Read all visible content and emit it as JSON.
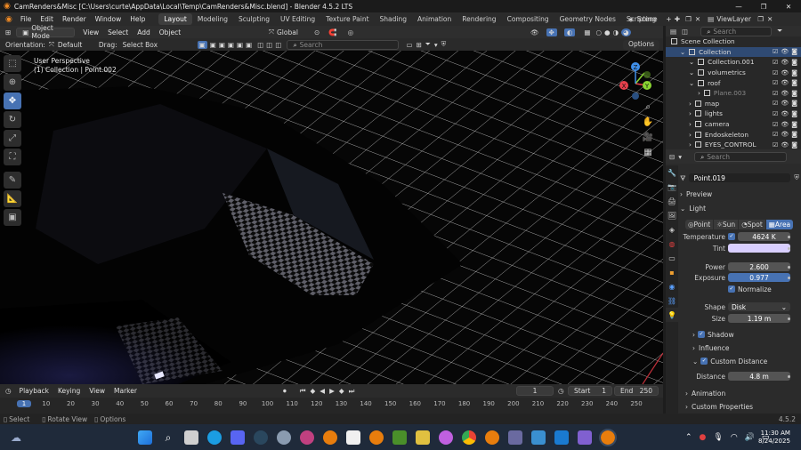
{
  "titlebar": {
    "title": "CamRenders&Misc [C:\\Users\\curte\\AppData\\Local\\Temp\\CamRenders&Misc.blend] - Blender 4.5.2 LTS"
  },
  "menubar": {
    "items": [
      "File",
      "Edit",
      "Render",
      "Window",
      "Help"
    ],
    "workspaces": [
      "Layout",
      "Modeling",
      "Sculpting",
      "UV Editing",
      "Texture Paint",
      "Shading",
      "Animation",
      "Rendering",
      "Compositing",
      "Geometry Nodes",
      "Scripting"
    ],
    "scene": "Scene",
    "view_layer": "ViewLayer"
  },
  "viewport_header": {
    "mode": "Object Mode",
    "menus": [
      "View",
      "Select",
      "Add",
      "Object"
    ],
    "transform": "Global"
  },
  "orientation_bar": {
    "orientation_label": "Orientation:",
    "orientation_value": "Default",
    "drag_label": "Drag:",
    "drag_value": "Select Box",
    "search_placeholder": "Search",
    "options": "Options"
  },
  "viewport": {
    "perspective": "User Perspective",
    "collection_info": "(1) Collection | Point.002"
  },
  "gizmo": {
    "x": "X",
    "y": "Y",
    "z": "Z"
  },
  "timeline": {
    "menus": [
      "Playback",
      "Keying",
      "View",
      "Marker"
    ],
    "current_frame": "1",
    "start_label": "Start",
    "start": "1",
    "end_label": "End",
    "end": "250",
    "ticks": [
      "1",
      "10",
      "20",
      "30",
      "40",
      "50",
      "60",
      "70",
      "80",
      "90",
      "100",
      "110",
      "120",
      "130",
      "140",
      "150",
      "160",
      "170",
      "180",
      "190",
      "200",
      "210",
      "220",
      "230",
      "240",
      "250"
    ]
  },
  "statusbar": {
    "select": "Select",
    "rotate": "Rotate View",
    "options": "Options",
    "version": "4.5.2"
  },
  "outliner": {
    "search_placeholder": "Search",
    "items": [
      {
        "name": "Scene Collection",
        "indent": 0
      },
      {
        "name": "Collection",
        "indent": 1
      },
      {
        "name": "Collection.001",
        "indent": 2
      },
      {
        "name": "volumetrics",
        "indent": 2
      },
      {
        "name": "roof",
        "indent": 2
      },
      {
        "name": "Plane.003",
        "indent": 3
      },
      {
        "name": "map",
        "indent": 2
      },
      {
        "name": "lights",
        "indent": 2
      },
      {
        "name": "camera",
        "indent": 2
      },
      {
        "name": "Endoskeleton",
        "indent": 2
      },
      {
        "name": "EYES_CONTROL",
        "indent": 2
      }
    ]
  },
  "properties": {
    "search_placeholder": "Search",
    "object_name": "Point.019",
    "preview": "Preview",
    "light": "Light",
    "light_types": [
      "Point",
      "Sun",
      "Spot",
      "Area"
    ],
    "temperature_label": "Temperature",
    "temperature": "4624 K",
    "tint_label": "Tint",
    "tint_color": "#d9cfff",
    "power_label": "Power",
    "power": "2.600",
    "exposure_label": "Exposure",
    "exposure": "0.977",
    "normalize": "Normalize",
    "shape_label": "Shape",
    "shape": "Disk",
    "size_label": "Size",
    "size": "1.19 m",
    "shadow": "Shadow",
    "influence": "Influence",
    "custom_distance": "Custom Distance",
    "distance_label": "Distance",
    "distance": "4.8 m",
    "animation": "Animation",
    "custom_properties": "Custom Properties"
  },
  "taskbar": {
    "time": "11:30 AM",
    "date": "8/24/2025"
  },
  "colors": {
    "accent": "#4772b3",
    "selection": "#2f4a73",
    "grid": "#d8d8d8",
    "gizmo_x": "#e6404c",
    "gizmo_y": "#8ad432",
    "gizmo_z": "#3f8ee8"
  }
}
